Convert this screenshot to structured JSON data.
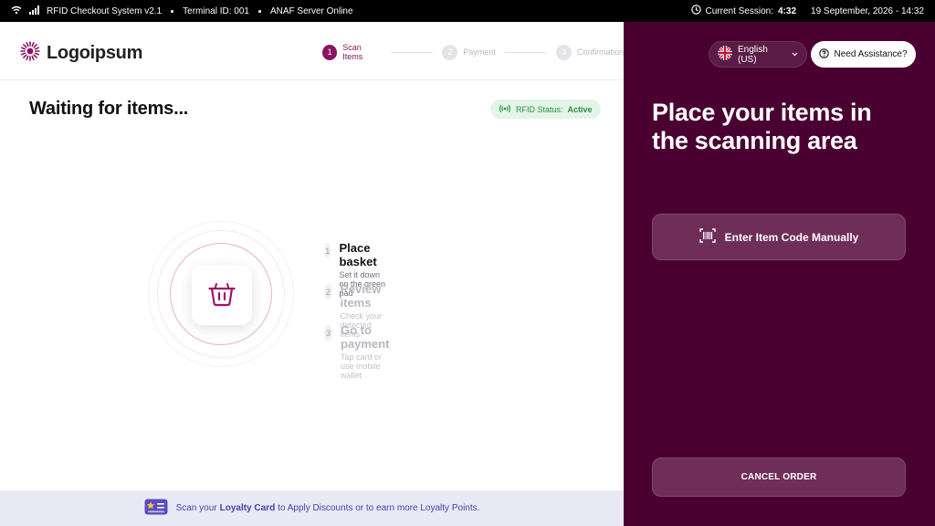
{
  "status_bar": {
    "app_name": "RFID Checkout System v2.1",
    "terminal": "Terminal ID: 001",
    "server_status": "ANAF Server Online",
    "session_label": "Current Session:",
    "session_time": "4:32",
    "datetime": "19 September, 2026 - 14:32",
    "icons": [
      "wifi-icon",
      "signal-icon",
      "clock-icon"
    ]
  },
  "header": {
    "logo_text": "Logoipsum",
    "steps": [
      {
        "num": "1",
        "label": "Scan Items",
        "active": true
      },
      {
        "num": "2",
        "label": "Payment",
        "active": false
      },
      {
        "num": "3",
        "label": "Confirmation",
        "active": false
      }
    ]
  },
  "main": {
    "title": "Waiting for items...",
    "rfid_label": "RFID Status:",
    "rfid_value": "Active",
    "steps": [
      {
        "num": "1",
        "title": "Place basket",
        "subtitle": "Set it down on the green pad"
      },
      {
        "num": "2",
        "title": "Review items",
        "subtitle": "Check your detected items"
      },
      {
        "num": "3",
        "title": "Go to payment",
        "subtitle": "Tap card or use mobile wallet"
      }
    ]
  },
  "loyalty": {
    "prefix": "Scan your",
    "highlight": "Loyalty Card",
    "suffix": "to Apply Discounts or to earn more Loyalty Points."
  },
  "right_panel": {
    "language": "English (US)",
    "help": "Need Assistance?",
    "headline": "Place your items in the scanning area",
    "manual_entry": "Enter Item Code Manually",
    "cancel": "CANCEL ORDER"
  },
  "colors": {
    "brand": "#8a1460",
    "panel": "#4a0131",
    "rfid_green": "#2d8b45",
    "loyalty_text": "#4a3ea8"
  }
}
